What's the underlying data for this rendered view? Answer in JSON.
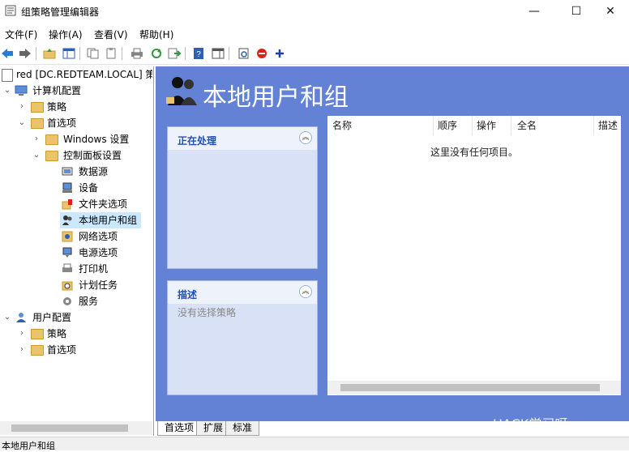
{
  "window": {
    "title": "组策略管理编辑器",
    "minimize": "—",
    "maximize": "☐",
    "close": "✕"
  },
  "menu": [
    "文件(F)",
    "操作(A)",
    "查看(V)",
    "帮助(H)"
  ],
  "toolbar": {
    "icons": [
      "back-icon",
      "forward-icon",
      "up-folder-icon",
      "show-hide-tree-icon",
      "copy-icon",
      "paste-icon",
      "print-icon",
      "refresh-icon",
      "export-list-icon",
      "help-icon",
      "show-action-pane-icon",
      "new-item-icon",
      "delete-icon",
      "add-icon"
    ]
  },
  "tree": {
    "root": "red [DC.REDTEAM.LOCAL] 策",
    "computer_config": "计算机配置",
    "policies": "策略",
    "preferences": "首选项",
    "windows_settings": "Windows 设置",
    "control_panel": "控制面板设置",
    "datasource": "数据源",
    "devices": "设备",
    "folder_options": "文件夹选项",
    "local_users": "本地用户和组",
    "network_options": "网络选项",
    "power_options": "电源选项",
    "printers": "打印机",
    "scheduled_tasks": "计划任务",
    "services": "服务",
    "user_config": "用户配置",
    "user_policies": "策略",
    "user_preferences": "首选项"
  },
  "main": {
    "heading": "本地用户和组",
    "processing_panel": {
      "title": "正在处理"
    },
    "description_panel": {
      "title": "描述",
      "text": "没有选择策略"
    },
    "list": {
      "columns": [
        "名称",
        "顺序",
        "操作",
        "全名",
        "描述"
      ],
      "empty_message": "这里没有任何项目。"
    }
  },
  "tabs": [
    "首选项",
    "扩展",
    "标准"
  ],
  "watermark": "HACK学习呀",
  "status": "本地用户和组"
}
